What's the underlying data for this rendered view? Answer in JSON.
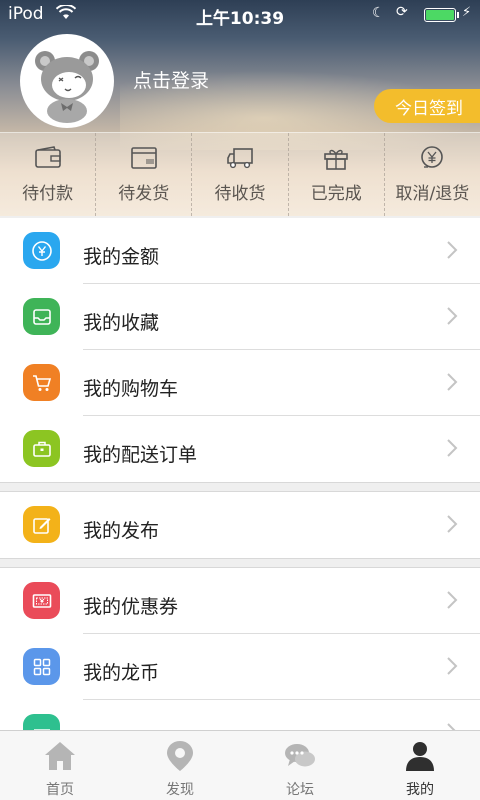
{
  "status_bar": {
    "carrier": "iPod",
    "time": "上午10:39"
  },
  "profile": {
    "login_text": "点击登录",
    "checkin_button": "今日签到"
  },
  "orders": [
    {
      "label": "待付款",
      "icon": "wallet-icon"
    },
    {
      "label": "待发货",
      "icon": "box-icon"
    },
    {
      "label": "待收货",
      "icon": "truck-icon"
    },
    {
      "label": "已完成",
      "icon": "gift-icon"
    },
    {
      "label": "取消/退货",
      "icon": "yen-refund-icon"
    }
  ],
  "menu": {
    "group1": [
      {
        "label": "我的金额",
        "icon": "yen-coin-icon",
        "color": "#2aa7ef"
      },
      {
        "label": "我的收藏",
        "icon": "tray-icon",
        "color": "#3fb458"
      },
      {
        "label": "我的购物车",
        "icon": "cart-icon",
        "color": "#f08024"
      },
      {
        "label": "我的配送订单",
        "icon": "briefcase-icon",
        "color": "#8cc522"
      }
    ],
    "group2": [
      {
        "label": "我的发布",
        "icon": "edit-icon",
        "color": "#f3b219"
      }
    ],
    "group3": [
      {
        "label": "我的优惠券",
        "icon": "coupon-icon",
        "color": "#ea4b59"
      },
      {
        "label": "我的龙币",
        "icon": "grid-icon",
        "color": "#5b97ea"
      },
      {
        "label": "",
        "icon": "shop-icon",
        "color": "#2ec08f"
      }
    ]
  },
  "tabs": [
    {
      "label": "首页",
      "icon": "home-icon"
    },
    {
      "label": "发现",
      "icon": "location-icon"
    },
    {
      "label": "论坛",
      "icon": "chat-icon"
    },
    {
      "label": "我的",
      "icon": "person-icon",
      "active": true
    }
  ]
}
